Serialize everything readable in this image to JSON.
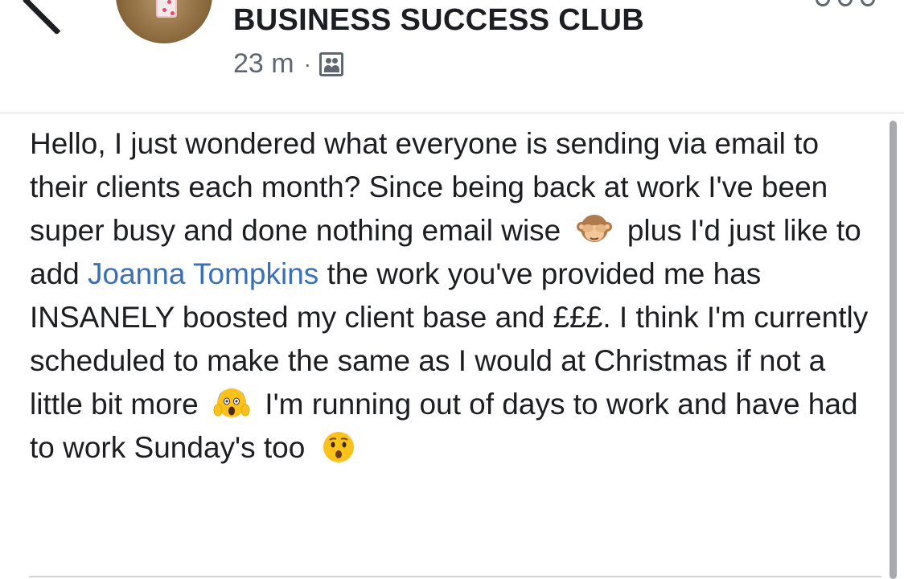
{
  "header": {
    "group_name": "BUSINESS SUCCESS CLUB",
    "timestamp": "23 m",
    "separator": "·",
    "audience_icon": "group-audience-icon"
  },
  "post": {
    "text_1": "Hello, I just wondered what everyone is sending via email to their clients each month? Since being back at work I've been super busy and done nothing email wise",
    "emoji_1": "see-no-evil-monkey",
    "text_2": " plus I'd just like to add ",
    "mention": "Joanna Tompkins",
    "text_3": " the work you've provided me has INSANELY boosted my client base and £££. I think I'm currently scheduled to make the same as I would at Christmas if not a little bit more",
    "emoji_2": "face-screaming-in-fear",
    "text_4": " I'm running out of days to work and have had to work Sunday's too",
    "emoji_3": "hushed-face"
  },
  "colors": {
    "mention": "#3b6fb6",
    "text": "#1c1e21",
    "meta": "#606770"
  }
}
